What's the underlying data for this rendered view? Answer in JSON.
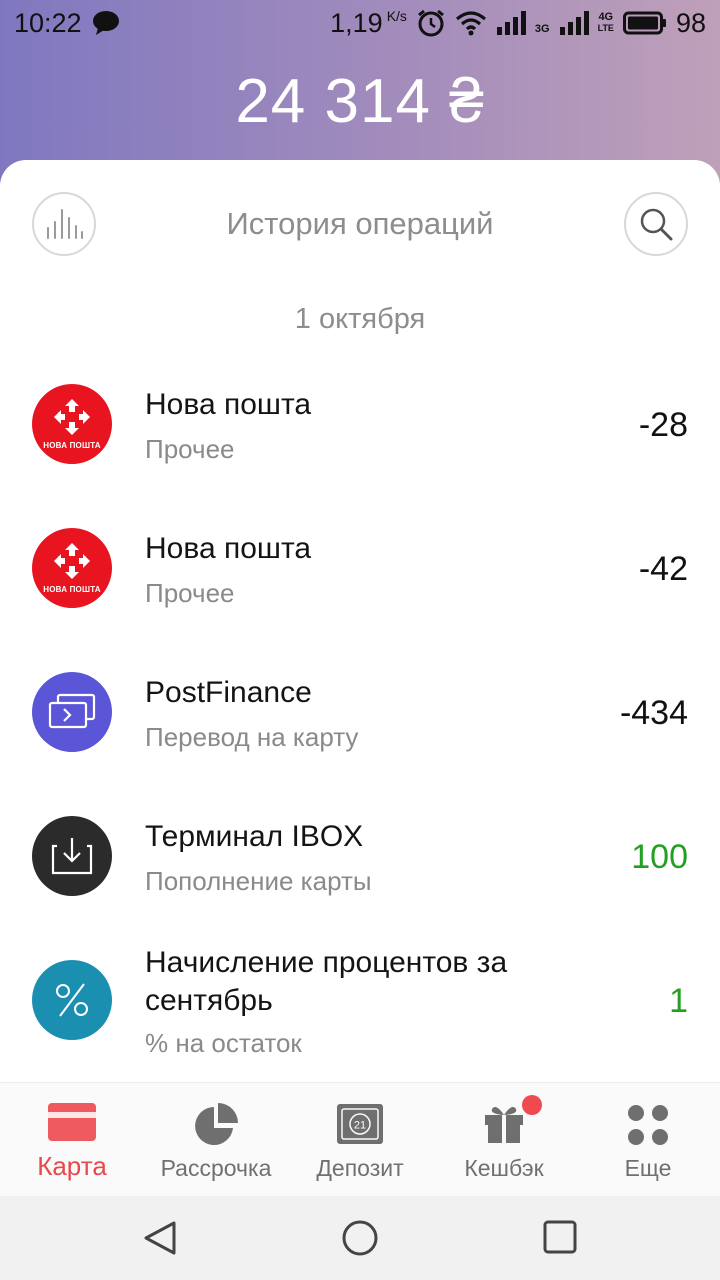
{
  "status_bar": {
    "time": "10:22",
    "speed": "1,19",
    "speed_unit": "K/s",
    "network_3g": "3G",
    "network_4g": "4G",
    "network_lte": "LTE",
    "battery": "98",
    "icons": [
      "message-icon",
      "alarm-icon",
      "wifi-icon",
      "signal-icon",
      "signal-3g-icon",
      "signal-4g-icon",
      "battery-icon"
    ]
  },
  "header": {
    "balance": "24 314 ₴"
  },
  "history": {
    "title": "История операций",
    "date": "1 октября",
    "transactions": [
      {
        "name": "Нова пошта",
        "category": "Прочее",
        "amount": "-28",
        "icon": "nova-poshta-logo",
        "color": "#e8141f",
        "logo_text": "НОВА ПОШТА"
      },
      {
        "name": "Нова пошта",
        "category": "Прочее",
        "amount": "-42",
        "icon": "nova-poshta-logo",
        "color": "#e8141f",
        "logo_text": "НОВА ПОШТА"
      },
      {
        "name": "PostFinance",
        "category": "Перевод на карту",
        "amount": "-434",
        "icon": "card-transfer-icon",
        "color": "#5b55d8"
      },
      {
        "name": "Терминал IBOX",
        "category": "Пополнение карты",
        "amount": "100",
        "icon": "top-up-icon",
        "color": "#2b2b2b"
      },
      {
        "name": "Начисление процентов за сентябрь",
        "category": "% на остаток",
        "amount": "1",
        "icon": "percent-icon",
        "color": "#1a8fb0"
      }
    ]
  },
  "tabs": [
    {
      "label": "Карта",
      "icon": "card-icon",
      "active": true
    },
    {
      "label": "Рассрочка",
      "icon": "pie-chart-icon",
      "active": false
    },
    {
      "label": "Депозит",
      "icon": "deposit-icon",
      "active": false,
      "badge_text": "21"
    },
    {
      "label": "Кешбэк",
      "icon": "gift-icon",
      "active": false,
      "has_dot": true
    },
    {
      "label": "Еще",
      "icon": "more-icon",
      "active": false
    }
  ],
  "colors": {
    "accent": "#e8474b",
    "positive": "#22a022",
    "header_gradient": [
      "#7f78c0",
      "#bfa0b9"
    ]
  }
}
